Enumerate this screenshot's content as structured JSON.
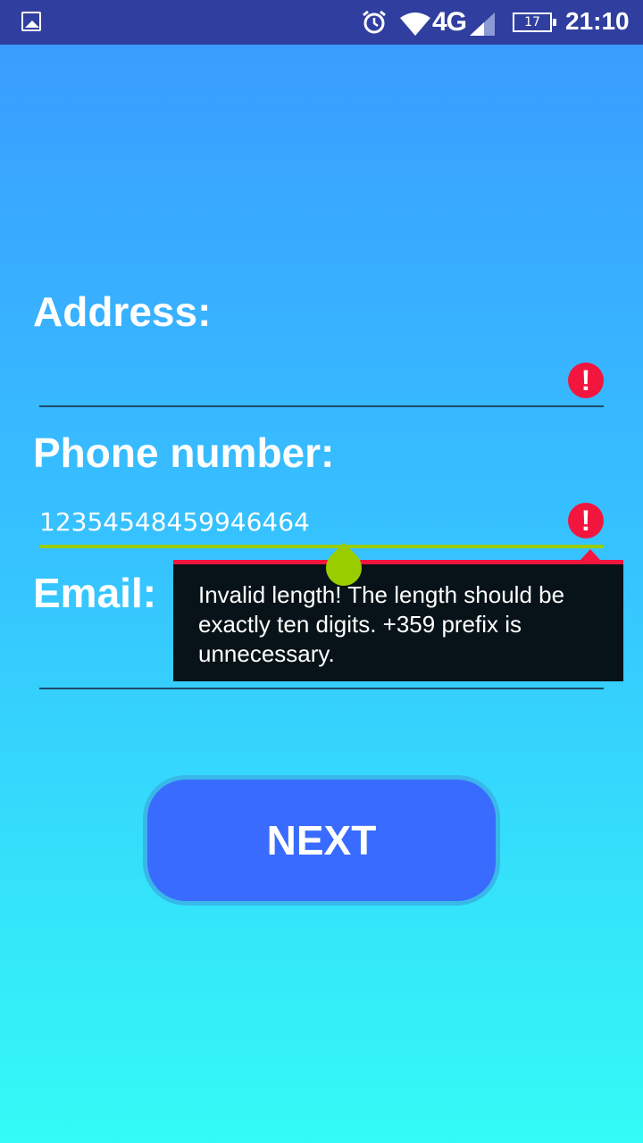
{
  "status_bar": {
    "network": "4G",
    "battery": "17",
    "time": "21:10",
    "icons": [
      "image-icon",
      "alarm-icon",
      "wifi-icon",
      "signal-icon",
      "battery-icon"
    ]
  },
  "form": {
    "address": {
      "label": "Address:",
      "value": "",
      "error_icon": "!"
    },
    "phone": {
      "label": "Phone number:",
      "value": "12354548459946464",
      "error_icon": "!"
    },
    "email": {
      "label": "Email:",
      "value": ""
    },
    "error_message": "Invalid length! The length should be exactly ten digits. +359 prefix is unnecessary."
  },
  "next_button": {
    "label": "NEXT"
  },
  "colors": {
    "status_bar": "#303f9f",
    "error": "#f2163e",
    "focus_underline": "#9acd00",
    "button": "#3a6bff",
    "tooltip_bg": "#081319"
  }
}
